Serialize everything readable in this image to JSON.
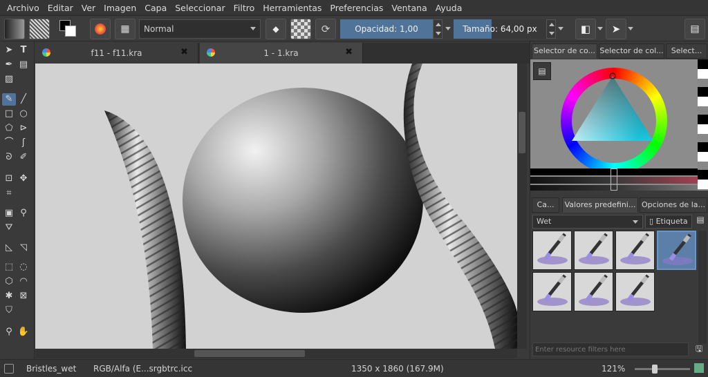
{
  "menu": [
    "Archivo",
    "Editar",
    "Ver",
    "Imagen",
    "Capa",
    "Seleccionar",
    "Filtro",
    "Herramientas",
    "Preferencias",
    "Ventana",
    "Ayuda"
  ],
  "toolbar": {
    "blend_mode": "Normal",
    "opacity_label": "Opacidad:",
    "opacity_value": "1,00",
    "size_label": "Tamaño:",
    "size_value": "64,00 px"
  },
  "tabs": [
    {
      "label": "f11 - f11.kra"
    },
    {
      "label": "1 - 1.kra"
    }
  ],
  "color_dock_tabs": [
    "Selector de co...",
    "Selector de col...",
    "Select..."
  ],
  "preset_dock_tabs": [
    "Ca...",
    "Valores predefini...",
    "Opciones de la..."
  ],
  "presets": {
    "filter_value": "Wet",
    "tag_label": "Etiqueta",
    "search_placeholder": "Enter resource filters here",
    "selected_index": 3,
    "count": 7
  },
  "status": {
    "brush": "Bristles_wet",
    "color_space": "RGB/Alfa (E...srgbtrc.icc",
    "dimensions": "1350 x 1860 (167.9M)",
    "zoom": "121%"
  },
  "colors": {
    "accent": "#4f7399",
    "canvas": "#d2d2d2",
    "panel": "#3a3a3a"
  }
}
